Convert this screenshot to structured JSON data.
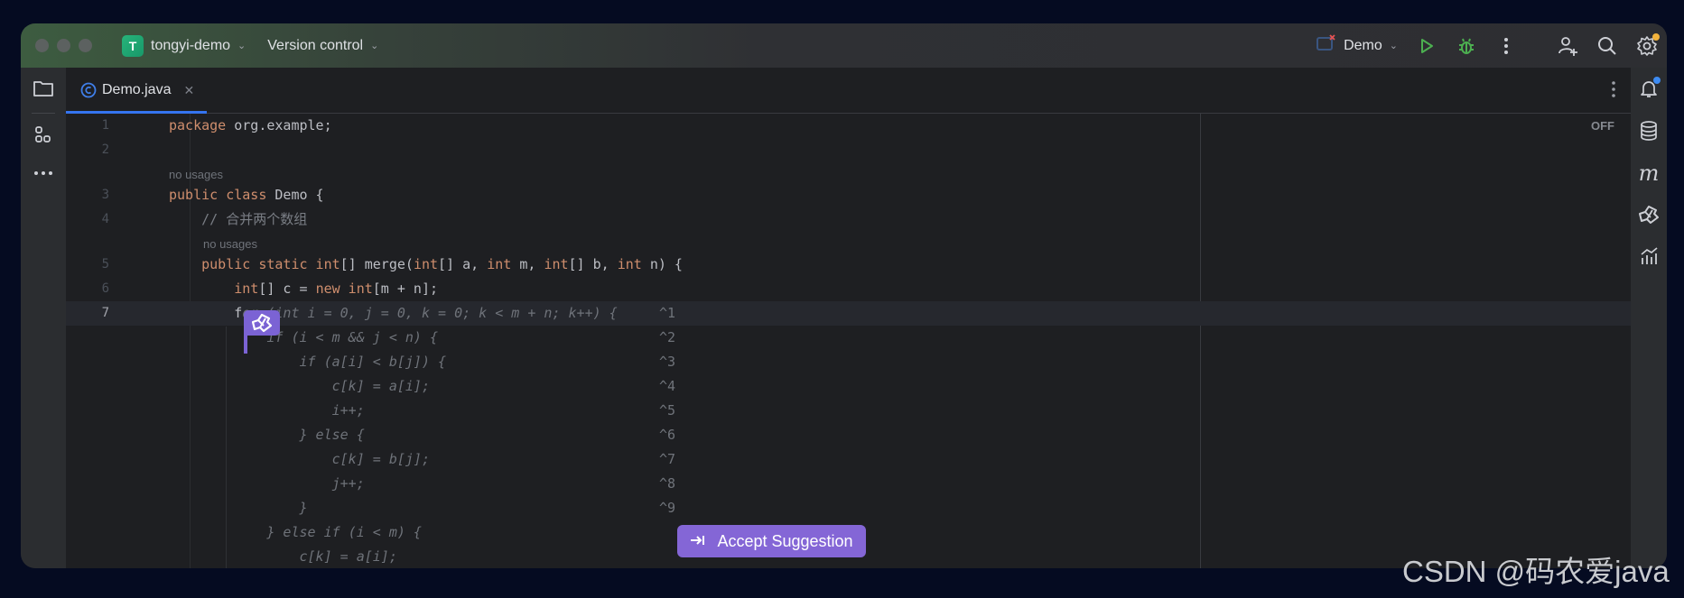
{
  "titlebar": {
    "project_badge": "T",
    "project_name": "tongyi-demo",
    "version_control": "Version control",
    "run_config": "Demo"
  },
  "tabs": [
    {
      "label": "Demo.java",
      "active": true
    }
  ],
  "editor": {
    "inspection_status": "OFF",
    "lines": [
      {
        "n": "1",
        "parts": [
          [
            "kw",
            "package"
          ],
          [
            "",
            " org.example;"
          ]
        ]
      },
      {
        "n": "2",
        "parts": []
      },
      {
        "hint": "no usages",
        "indent": 0
      },
      {
        "n": "3",
        "parts": [
          [
            "kw",
            "public class"
          ],
          [
            "",
            " Demo {"
          ]
        ]
      },
      {
        "n": "4",
        "parts": [
          [
            "cmt",
            "    // 合并两个数组"
          ]
        ]
      },
      {
        "hint": "no usages",
        "indent": 1
      },
      {
        "n": "5",
        "parts": [
          [
            "",
            "    "
          ],
          [
            "kw",
            "public static int"
          ],
          [
            "",
            "[] merge("
          ],
          [
            "kw",
            "int"
          ],
          [
            "",
            "[] a, "
          ],
          [
            "kw",
            "int"
          ],
          [
            "",
            " m, "
          ],
          [
            "kw",
            "int"
          ],
          [
            "",
            "[] b, "
          ],
          [
            "kw",
            "int"
          ],
          [
            "",
            " n) {"
          ]
        ]
      },
      {
        "n": "6",
        "parts": [
          [
            "",
            "        "
          ],
          [
            "kw",
            "int"
          ],
          [
            "",
            "[] c = "
          ],
          [
            "kw",
            "new int"
          ],
          [
            "",
            "[m + n];"
          ]
        ]
      },
      {
        "n": "7",
        "current": true,
        "parts": [
          [
            "",
            "        f"
          ],
          [
            "ghost",
            "or (int i = 0, j = 0, k = 0; k < m + n; k++) {"
          ]
        ],
        "ghost_hint": "^1"
      },
      {
        "parts": [
          [
            "ghost",
            "            if (i < m && j < n) {"
          ]
        ],
        "ghost_hint": "^2"
      },
      {
        "parts": [
          [
            "ghost",
            "                if (a[i] < b[j]) {"
          ]
        ],
        "ghost_hint": "^3"
      },
      {
        "parts": [
          [
            "ghost",
            "                    c[k] = a[i];"
          ]
        ],
        "ghost_hint": "^4"
      },
      {
        "parts": [
          [
            "ghost",
            "                    i++;"
          ]
        ],
        "ghost_hint": "^5"
      },
      {
        "parts": [
          [
            "ghost",
            "                } else {"
          ]
        ],
        "ghost_hint": "^6"
      },
      {
        "parts": [
          [
            "ghost",
            "                    c[k] = b[j];"
          ]
        ],
        "ghost_hint": "^7"
      },
      {
        "parts": [
          [
            "ghost",
            "                    j++;"
          ]
        ],
        "ghost_hint": "^8"
      },
      {
        "parts": [
          [
            "ghost",
            "                }"
          ]
        ],
        "ghost_hint": "^9"
      },
      {
        "parts": [
          [
            "ghost",
            "            } else if (i < m) {"
          ]
        ]
      },
      {
        "parts": [
          [
            "ghost",
            "                c[k] = a[i];"
          ]
        ]
      }
    ]
  },
  "accept_suggestion": {
    "label": "Accept Suggestion",
    "shortcut_icon": "tab-arrow-icon"
  },
  "colors": {
    "accent": "#3574f0",
    "ai_purple": "#8466d6",
    "keyword": "#cf8e6d",
    "run_green": "#4caf50"
  },
  "watermark": "CSDN @码农爱java"
}
